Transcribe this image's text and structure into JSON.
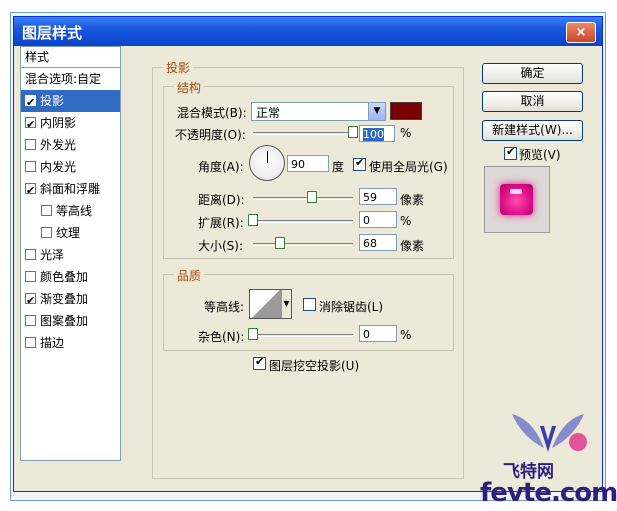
{
  "window": {
    "title": "图层样式",
    "close": "×"
  },
  "styles_list": {
    "header": "样式",
    "items": [
      {
        "label": "混合选项:自定",
        "checkbox": false,
        "checked": false,
        "selected": false,
        "sub": false
      },
      {
        "label": "投影",
        "checkbox": true,
        "checked": true,
        "selected": true,
        "sub": false
      },
      {
        "label": "内阴影",
        "checkbox": true,
        "checked": true,
        "selected": false,
        "sub": false
      },
      {
        "label": "外发光",
        "checkbox": true,
        "checked": false,
        "selected": false,
        "sub": false
      },
      {
        "label": "内发光",
        "checkbox": true,
        "checked": false,
        "selected": false,
        "sub": false
      },
      {
        "label": "斜面和浮雕",
        "checkbox": true,
        "checked": true,
        "selected": false,
        "sub": false
      },
      {
        "label": "等高线",
        "checkbox": true,
        "checked": false,
        "selected": false,
        "sub": true
      },
      {
        "label": "纹理",
        "checkbox": true,
        "checked": false,
        "selected": false,
        "sub": true
      },
      {
        "label": "光泽",
        "checkbox": true,
        "checked": false,
        "selected": false,
        "sub": false
      },
      {
        "label": "颜色叠加",
        "checkbox": true,
        "checked": false,
        "selected": false,
        "sub": false
      },
      {
        "label": "渐变叠加",
        "checkbox": true,
        "checked": true,
        "selected": false,
        "sub": false
      },
      {
        "label": "图案叠加",
        "checkbox": true,
        "checked": false,
        "selected": false,
        "sub": false
      },
      {
        "label": "描边",
        "checkbox": true,
        "checked": false,
        "selected": false,
        "sub": false
      }
    ]
  },
  "panel": {
    "title": "投影",
    "structure": {
      "title": "结构",
      "blend_mode_label": "混合模式(B):",
      "blend_mode_value": "正常",
      "shadow_color": "#7a0000",
      "opacity_label": "不透明度(O):",
      "opacity_value": "100",
      "opacity_unit": "%",
      "opacity_level": 1.0,
      "angle_label": "角度(A):",
      "angle_value": "90",
      "angle_unit": "度",
      "global_light_label": "使用全局光(G)",
      "global_light_checked": true,
      "distance_label": "距离(D):",
      "distance_value": "59",
      "distance_unit": "像素",
      "distance_level": 0.59,
      "spread_label": "扩展(R):",
      "spread_value": "0",
      "spread_unit": "%",
      "spread_level": 0.0,
      "size_label": "大小(S):",
      "size_value": "68",
      "size_unit": "像素",
      "size_level": 0.27
    },
    "quality": {
      "title": "品质",
      "contour_label": "等高线:",
      "antialias_label": "消除锯齿(L)",
      "antialias_checked": false,
      "noise_label": "杂色(N):",
      "noise_value": "0",
      "noise_unit": "%",
      "noise_level": 0.0
    },
    "knockout_label": "图层挖空投影(U)",
    "knockout_checked": true
  },
  "buttons": {
    "ok": "确定",
    "cancel": "取消",
    "new_style": "新建样式(W)...",
    "preview_label": "预览(V)",
    "preview_checked": true
  },
  "watermark": {
    "zh": "飞特网",
    "en": "fevte.com"
  }
}
